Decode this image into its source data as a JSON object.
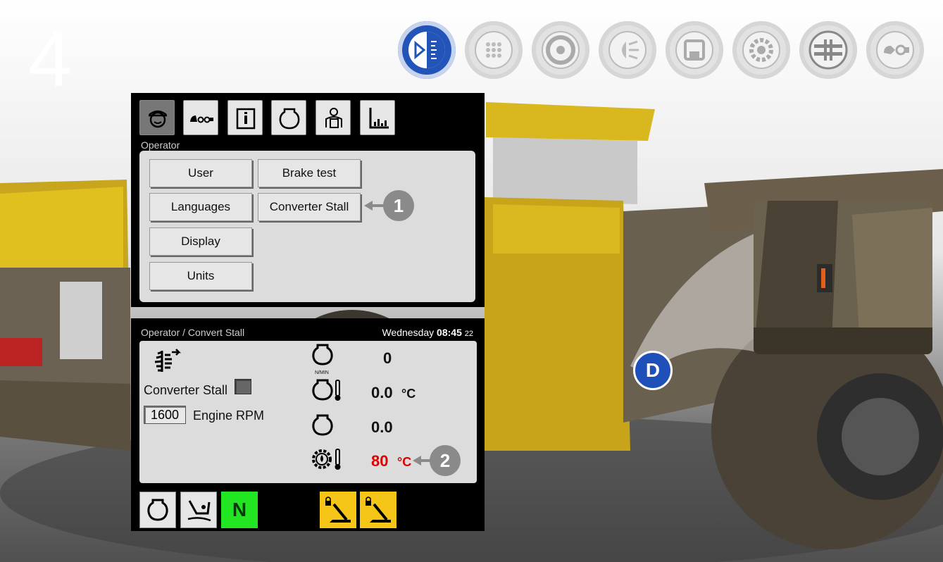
{
  "step_number": "4",
  "nav": {
    "items": [
      {
        "icon": "display-panel-icon",
        "active": true
      },
      {
        "icon": "gearbox-icon",
        "active": false
      },
      {
        "icon": "disc-brake-icon",
        "active": false
      },
      {
        "icon": "headlight-icon",
        "active": false
      },
      {
        "icon": "save-icon",
        "active": false
      },
      {
        "icon": "settings-gear-icon",
        "active": false
      },
      {
        "icon": "driveline-icon",
        "active": false
      },
      {
        "icon": "hydraulic-pump-icon",
        "active": false
      }
    ]
  },
  "menu_panel": {
    "tabs": [
      {
        "icon": "operator-icon",
        "selected": true
      },
      {
        "icon": "machine-view-icon",
        "selected": false
      },
      {
        "icon": "info-icon",
        "selected": false
      },
      {
        "icon": "engine-icon",
        "selected": false
      },
      {
        "icon": "service-icon",
        "selected": false
      },
      {
        "icon": "statistics-icon",
        "selected": false
      }
    ],
    "breadcrumb": "Operator",
    "buttons": {
      "user": "User",
      "brake_test": "Brake test",
      "languages": "Languages",
      "converter_stall": "Converter Stall",
      "display": "Display",
      "units": "Units"
    }
  },
  "stall_panel": {
    "breadcrumb": "Operator / Convert Stall",
    "date": {
      "day": "Wednesday",
      "time": "08:45",
      "seconds": "22"
    },
    "converter_stall_label": "Converter Stall",
    "engine_rpm_value": "1600",
    "engine_rpm_label": "Engine RPM",
    "readings": {
      "engine_speed": {
        "value": "0",
        "unit_small": "N/MIN"
      },
      "engine_temp": {
        "value": "0.0",
        "unit": "°C"
      },
      "engine_load": {
        "value": "0.0"
      },
      "transmission_oil_temp": {
        "value": "80",
        "unit": "°C"
      }
    },
    "bottom": {
      "gear_label": "N"
    }
  },
  "callouts": {
    "first": "1",
    "second": "2"
  },
  "location_badge": "D",
  "colors": {
    "active_nav": "#2355b8",
    "gear_neutral": "#22e622",
    "brake_warning": "#f5c518",
    "alert_value": "#e00000"
  }
}
